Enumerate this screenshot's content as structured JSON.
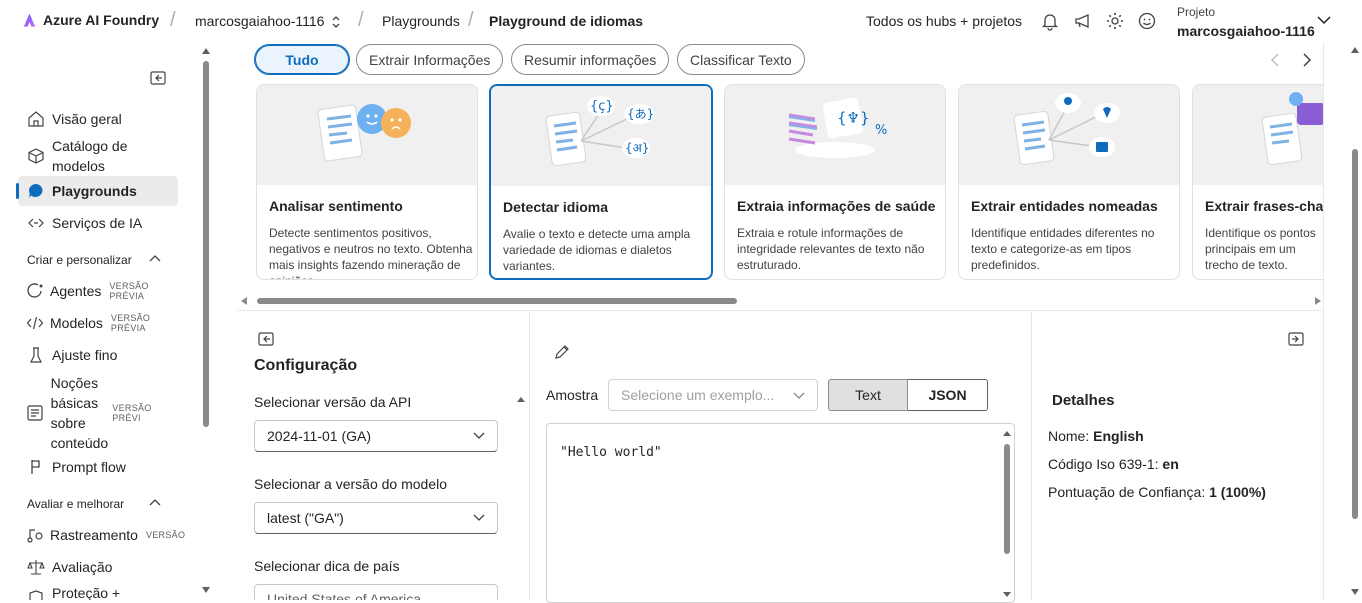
{
  "header": {
    "app_name": "Azure AI Foundry",
    "resource": "marcosgaiahoo-1116",
    "crumb_playgrounds": "Playgrounds",
    "crumb_current": "Playground de idiomas",
    "hubs_link": "Todos os hubs + projetos",
    "project_label": "Projeto",
    "project_name": "marcosgaiahoo-1116"
  },
  "sidebar": {
    "items": [
      {
        "label": "Visão geral"
      },
      {
        "label": "Catálogo de modelos"
      },
      {
        "label": "Playgrounds"
      },
      {
        "label": "Serviços de IA"
      }
    ],
    "section_create": "Criar e personalizar",
    "create_items": [
      {
        "label": "Agentes",
        "badge": "VERSÃO PRÉVIA"
      },
      {
        "label": "Modelos",
        "badge": "VERSÃO PRÉVIA"
      },
      {
        "label": "Ajuste fino"
      },
      {
        "label": "Noções básicas sobre conteúdo",
        "badge": "VERSÃO PRÉVI"
      },
      {
        "label": "Prompt flow"
      }
    ],
    "section_eval": "Avaliar e melhorar",
    "eval_items": [
      {
        "label": "Rastreamento",
        "badge": "VERSÃO"
      },
      {
        "label": "Avaliação"
      },
      {
        "label": "Proteção +"
      }
    ]
  },
  "filters": [
    "Tudo",
    "Extrair Informações",
    "Resumir informações",
    "Classificar Texto"
  ],
  "cards": [
    {
      "title": "Analisar sentimento",
      "desc": "Detecte sentimentos positivos, negativos e neutros no texto. Obtenha mais insights fazendo mineração de opiniões."
    },
    {
      "title": "Detectar idioma",
      "desc": "Avalie o texto e detecte uma ampla variedade de idiomas e dialetos variantes."
    },
    {
      "title": "Extraia informações de saúde",
      "desc": "Extraia e rotule informações de integridade relevantes de texto não estruturado."
    },
    {
      "title": "Extrair entidades nomeadas",
      "desc": "Identifique entidades diferentes no texto e categorize-as em tipos predefinidos."
    },
    {
      "title": "Extrair frases-chave",
      "desc": "Identifique os pontos principais em um trecho de texto."
    }
  ],
  "config": {
    "title": "Configuração",
    "api_label": "Selecionar versão da API",
    "api_value": "2024-11-01 (GA)",
    "model_label": "Selecionar a versão do modelo",
    "model_value": "latest (\"GA\")",
    "country_label": "Selecionar dica de país",
    "country_value": "United States of America"
  },
  "sample": {
    "label": "Amostra",
    "placeholder": "Selecione um exemplo...",
    "tab_text": "Text",
    "tab_json": "JSON",
    "input_text": "\"Hello world\""
  },
  "details": {
    "title": "Detalhes",
    "name_label": "Nome:",
    "name_value": "English",
    "iso_label": "Código Iso 639-1:",
    "iso_value": "en",
    "score_label": "Pontuação de Confiança:",
    "score_value": "1 (100%)"
  },
  "colors": {
    "accent": "#0f6cbd",
    "selected_bg": "#ebf3fc"
  }
}
